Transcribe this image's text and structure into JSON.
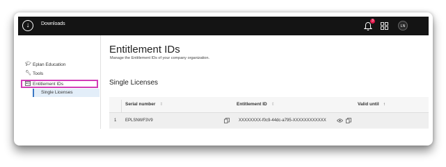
{
  "topbar": {
    "title": "Downloads",
    "notification_count": "3",
    "avatar_initials": "LN"
  },
  "sidebar": {
    "items": [
      {
        "label": "Eplan Education",
        "icon": "graduation-cap-icon"
      },
      {
        "label": "Tools",
        "icon": "wrench-icon"
      },
      {
        "label": "Entitlement IDs",
        "icon": "id-card-icon"
      }
    ],
    "sub_item": "Single Licenses"
  },
  "main": {
    "title": "Entitlement IDs",
    "subtitle": "Manage the Entitlement IDs of your company organization.",
    "section_title": "Single Licenses",
    "table": {
      "headers": [
        "Serial number",
        "Entitlement ID",
        "Valid until"
      ],
      "rows": [
        {
          "index": "1",
          "serial": "EPLSNWF3V9",
          "entitlement_id": "XXXXXXXX-f0c9-44dc-a795-XXXXXXXXXXXX"
        }
      ]
    }
  },
  "colors": {
    "topbar": "#141414",
    "highlight": "#d23cb7",
    "active_sub": "#e3eef9",
    "badge": "#e2184b"
  }
}
